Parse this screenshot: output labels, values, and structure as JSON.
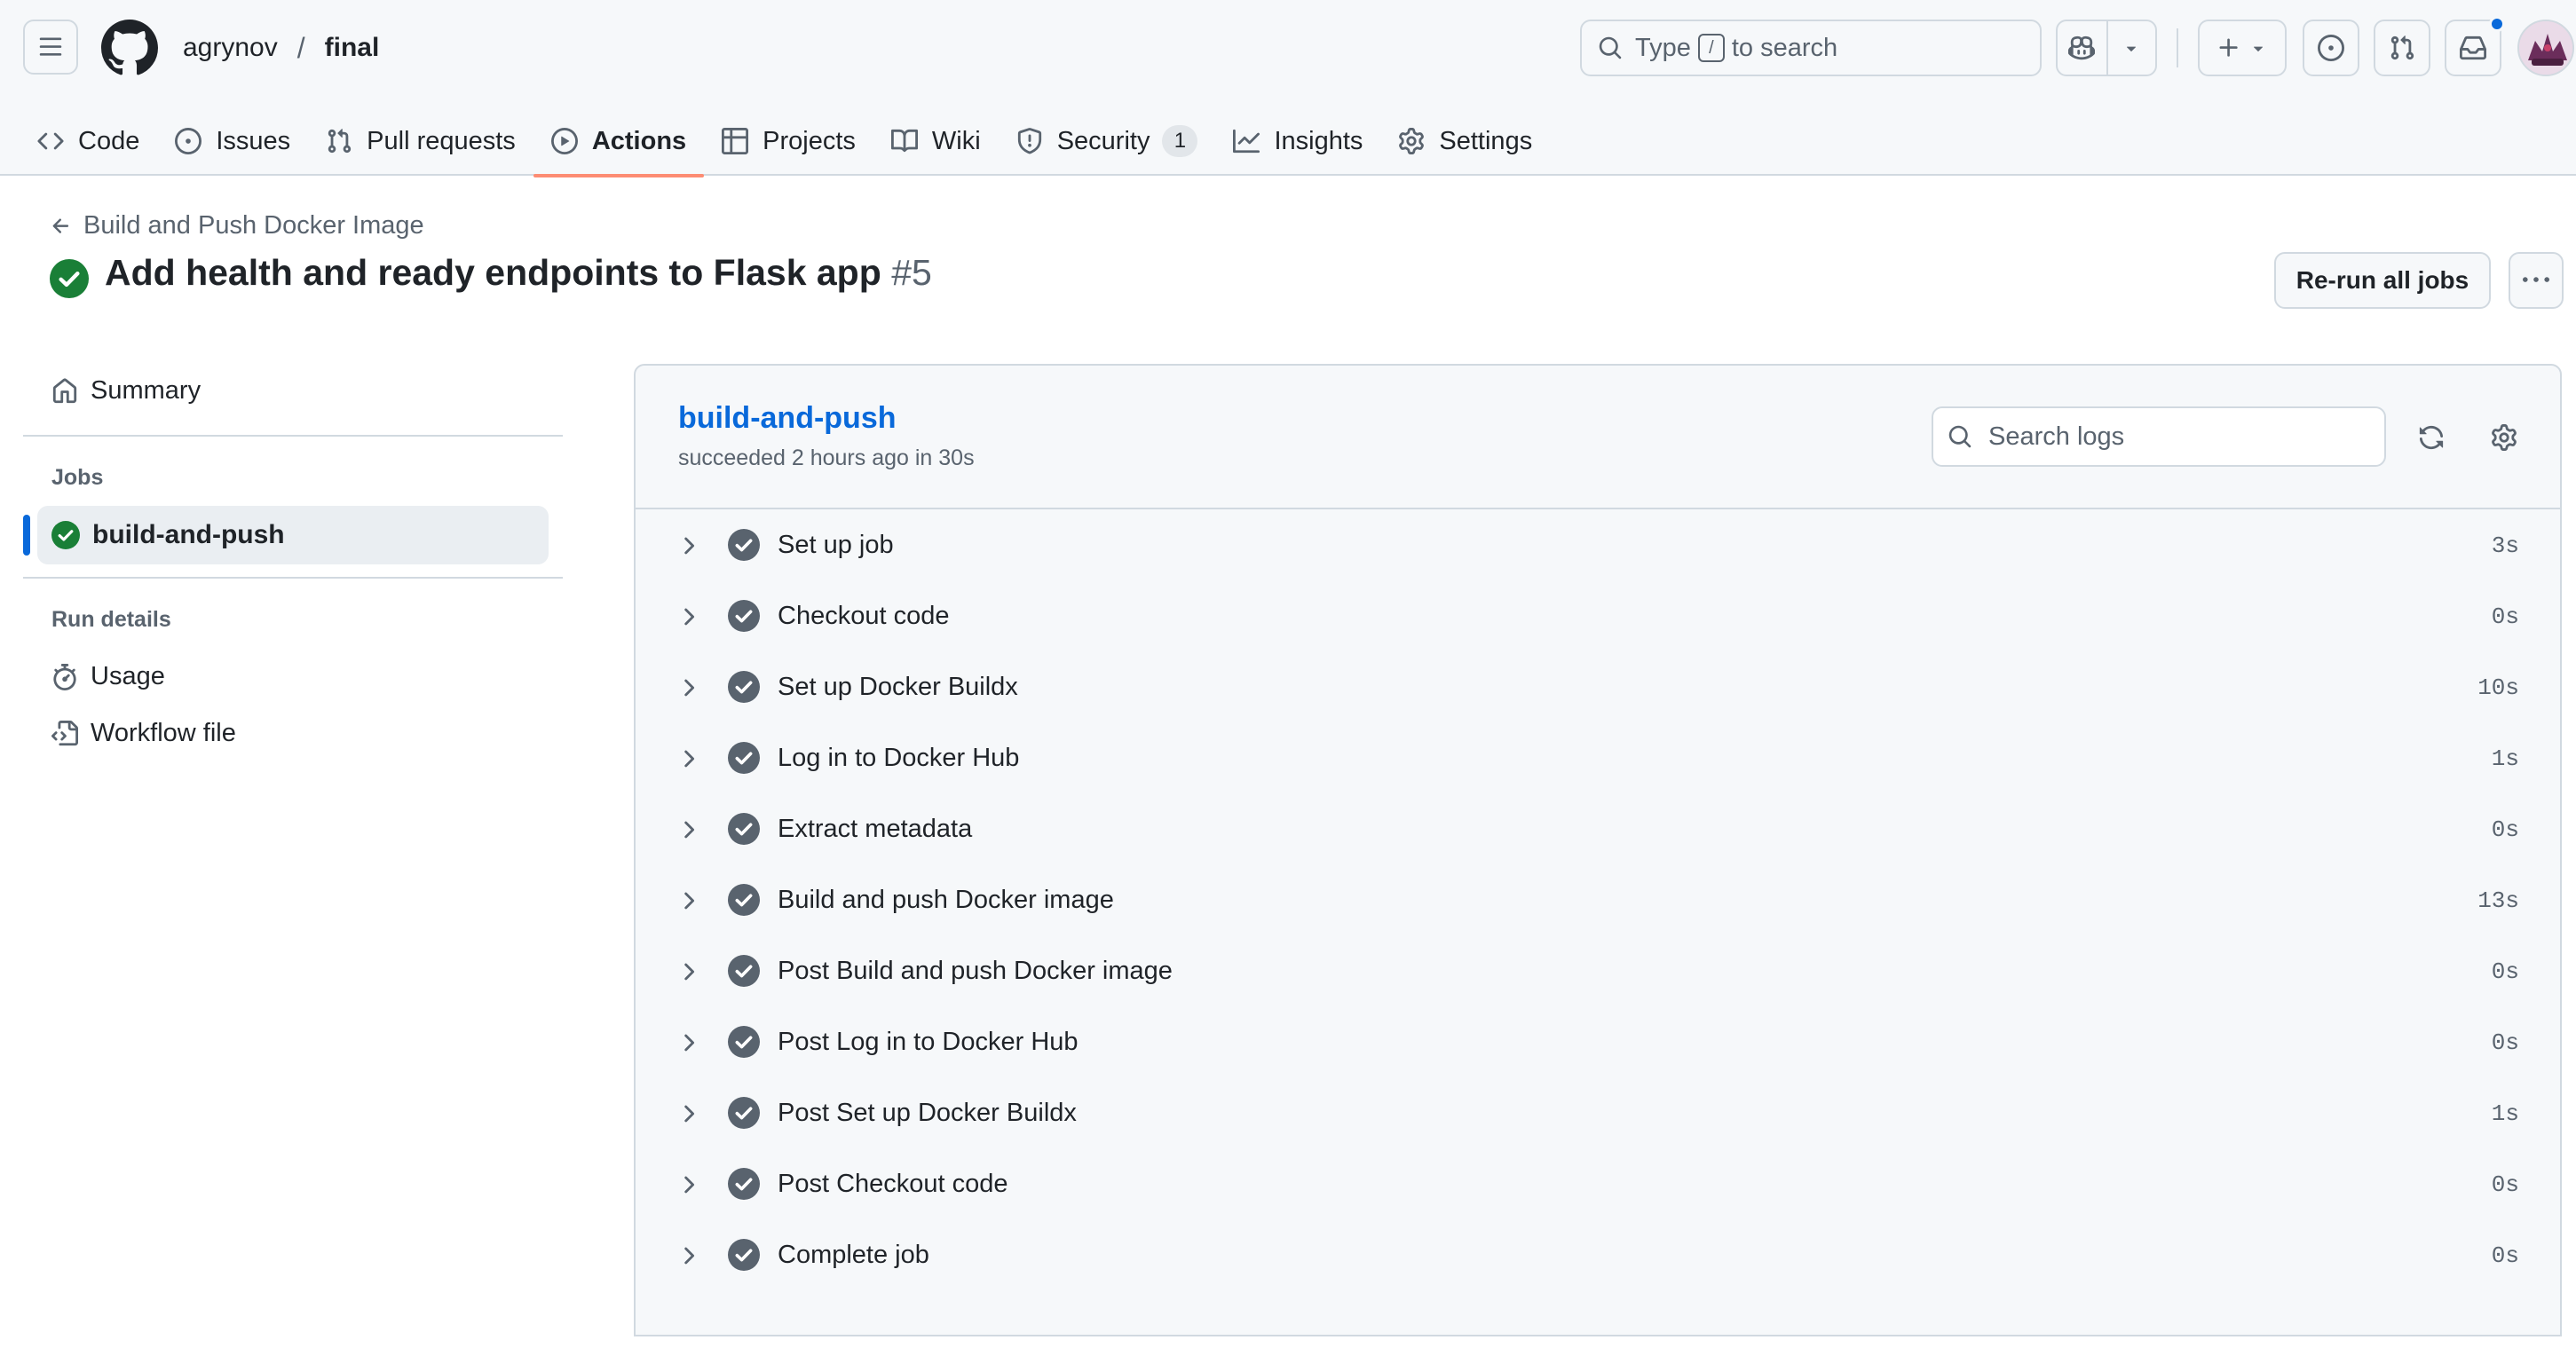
{
  "header": {
    "owner": "agrynov",
    "separator": "/",
    "repo": "final",
    "search": {
      "prefix": "Type",
      "key": "/",
      "suffix": "to search"
    },
    "icons": [
      "hamburger-icon",
      "github-logo",
      "search-icon",
      "copilot-icon",
      "triangle-down-icon",
      "plus-icon",
      "issue-opened-icon",
      "git-pull-request-icon",
      "inbox-icon"
    ]
  },
  "nav": {
    "tabs": [
      {
        "label": "Code",
        "icon": "code-icon"
      },
      {
        "label": "Issues",
        "icon": "issue-opened-icon"
      },
      {
        "label": "Pull requests",
        "icon": "git-pull-request-icon"
      },
      {
        "label": "Actions",
        "icon": "play-icon",
        "selected": true
      },
      {
        "label": "Projects",
        "icon": "table-icon"
      },
      {
        "label": "Wiki",
        "icon": "book-icon"
      },
      {
        "label": "Security",
        "icon": "shield-icon",
        "count": "1"
      },
      {
        "label": "Insights",
        "icon": "graph-icon"
      },
      {
        "label": "Settings",
        "icon": "gear-icon"
      }
    ]
  },
  "run": {
    "workflow_link": "Build and Push Docker Image",
    "title": "Add health and ready endpoints to Flask app",
    "number": "#5",
    "rerun_label": "Re-run all jobs"
  },
  "sidebar": {
    "summary": "Summary",
    "jobs_heading": "Jobs",
    "active_job": "build-and-push",
    "run_details_heading": "Run details",
    "usage": "Usage",
    "workflow_file": "Workflow file"
  },
  "job": {
    "name": "build-and-push",
    "meta": "succeeded 2 hours ago in 30s",
    "search_placeholder": "Search logs",
    "steps": [
      {
        "name": "Set up job",
        "duration": "3s"
      },
      {
        "name": "Checkout code",
        "duration": "0s"
      },
      {
        "name": "Set up Docker Buildx",
        "duration": "10s"
      },
      {
        "name": "Log in to Docker Hub",
        "duration": "1s"
      },
      {
        "name": "Extract metadata",
        "duration": "0s"
      },
      {
        "name": "Build and push Docker image",
        "duration": "13s"
      },
      {
        "name": "Post Build and push Docker image",
        "duration": "0s"
      },
      {
        "name": "Post Log in to Docker Hub",
        "duration": "0s"
      },
      {
        "name": "Post Set up Docker Buildx",
        "duration": "1s"
      },
      {
        "name": "Post Checkout code",
        "duration": "0s"
      },
      {
        "name": "Complete job",
        "duration": "0s"
      }
    ]
  },
  "colors": {
    "success": "#1a7f37",
    "step_done": "#59636e",
    "link": "#0969da",
    "tab_underline": "#fd8c73",
    "notification": "#0969da"
  }
}
